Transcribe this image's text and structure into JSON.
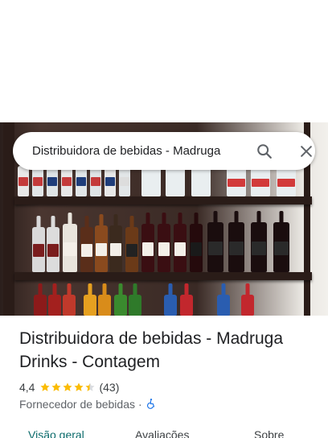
{
  "search": {
    "query": "Distribuidora de bebidas - Madruga",
    "search_icon": "search-icon",
    "close_icon": "close-icon"
  },
  "hero": {
    "image_icon": "place-photo"
  },
  "place": {
    "title": "Distribuidora de bebidas - Madruga Drinks - Contagem",
    "rating_value": "4,4",
    "rating_stars": 4.4,
    "review_count": "(43)",
    "category": "Fornecedor de bebidas",
    "separator": "·",
    "accessibility_icon": "wheelchair-icon"
  },
  "tabs": [
    {
      "label": "Visão geral",
      "active": true
    },
    {
      "label": "Avaliações",
      "active": false
    },
    {
      "label": "Sobre",
      "active": false
    }
  ],
  "colors": {
    "star": "#fbbc04",
    "active_tab": "#0b6b6b",
    "accessibility": "#1a73e8"
  }
}
